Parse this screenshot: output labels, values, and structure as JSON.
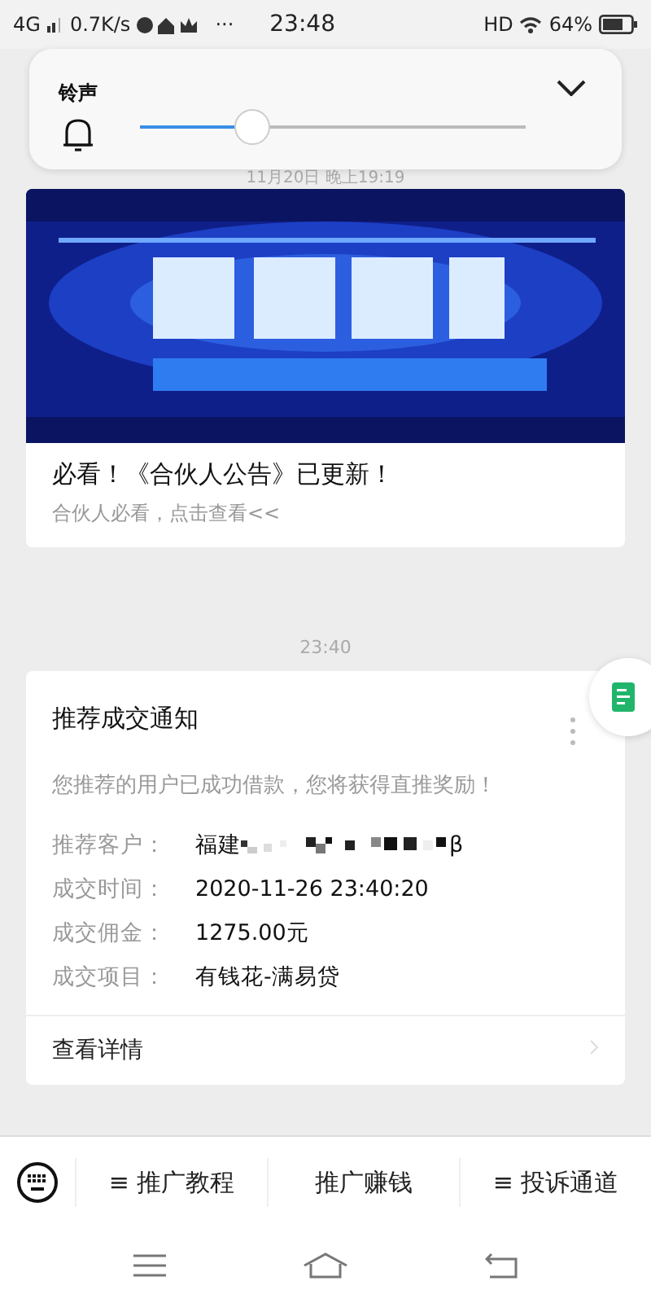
{
  "status_bar": {
    "network": "4G",
    "speed": "0.7K/s",
    "more": "···",
    "time": "23:48",
    "hd": "HD",
    "battery": "64%"
  },
  "volume_panel": {
    "label": "铃声",
    "level": 0.29
  },
  "date_stamp": "11月20日 晚上19:19",
  "announcement": {
    "title": "必看！《合伙人公告》已更新！",
    "subtitle": "合伙人必看，点击查看<<"
  },
  "time_stamp": "23:40",
  "deal_card": {
    "title": "推荐成交通知",
    "message": "您推荐的用户已成功借款，您将获得直推奖励！",
    "fields": [
      {
        "label": "推荐客户：",
        "value": "福建",
        "redacted": true,
        "suffix": "β"
      },
      {
        "label": "成交时间：",
        "value": "2020-11-26 23:40:20",
        "redacted": false
      },
      {
        "label": "成交佣金：",
        "value": "1275.00元",
        "redacted": false
      },
      {
        "label": "成交项目：",
        "value": "有钱花-满易贷",
        "redacted": false
      }
    ],
    "link": "查看详情"
  },
  "bottom_menu": [
    "≡ 推广教程",
    "推广赚钱",
    "≡ 投诉通道"
  ]
}
